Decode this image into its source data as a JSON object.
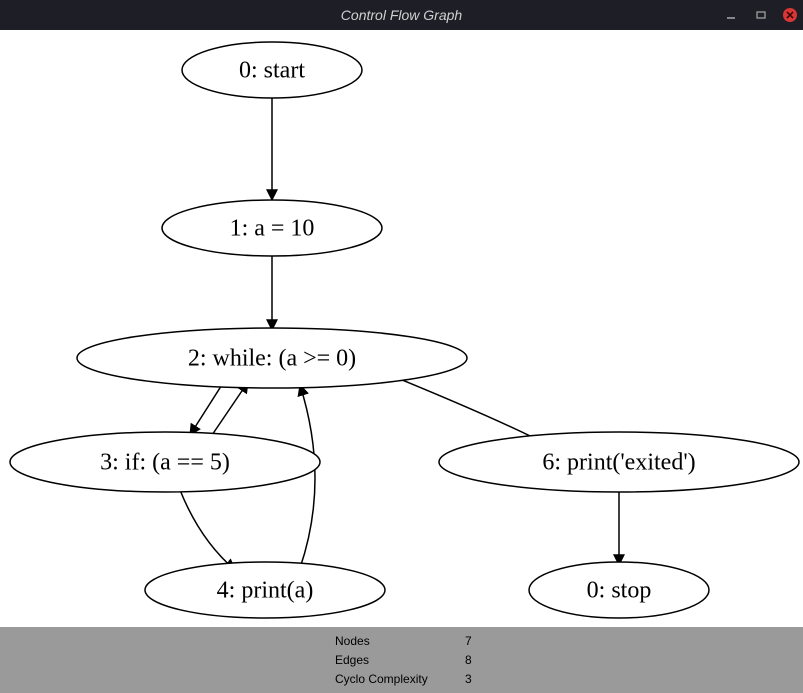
{
  "window": {
    "title": "Control Flow Graph"
  },
  "graph": {
    "nodes": {
      "n0": "0: start",
      "n1": "1: a = 10",
      "n2": "2: while: (a >= 0)",
      "n3": "3: if: (a == 5)",
      "n4": "4: print(a)",
      "n5": "6: print('exited')",
      "n6": "0: stop"
    }
  },
  "stats": {
    "nodes_label": "Nodes",
    "nodes_value": "7",
    "edges_label": "Edges",
    "edges_value": "8",
    "cyclo_label": "Cyclo Complexity",
    "cyclo_value": "3"
  },
  "chart_data": {
    "type": "graph",
    "title": "Control Flow Graph",
    "nodes": [
      {
        "id": 0,
        "label": "0: start"
      },
      {
        "id": 1,
        "label": "1: a = 10"
      },
      {
        "id": 2,
        "label": "2: while: (a >= 0)"
      },
      {
        "id": 3,
        "label": "3: if: (a == 5)"
      },
      {
        "id": 4,
        "label": "4: print(a)"
      },
      {
        "id": 6,
        "label": "6: print('exited')"
      },
      {
        "id": 7,
        "label": "0: stop"
      }
    ],
    "edges": [
      {
        "from": 0,
        "to": 1
      },
      {
        "from": 1,
        "to": 2
      },
      {
        "from": 2,
        "to": 3
      },
      {
        "from": 2,
        "to": 6
      },
      {
        "from": 3,
        "to": 2
      },
      {
        "from": 3,
        "to": 4
      },
      {
        "from": 4,
        "to": 2
      },
      {
        "from": 6,
        "to": 7
      }
    ],
    "metrics": {
      "nodes": 7,
      "edges": 8,
      "cyclomatic_complexity": 3
    }
  }
}
